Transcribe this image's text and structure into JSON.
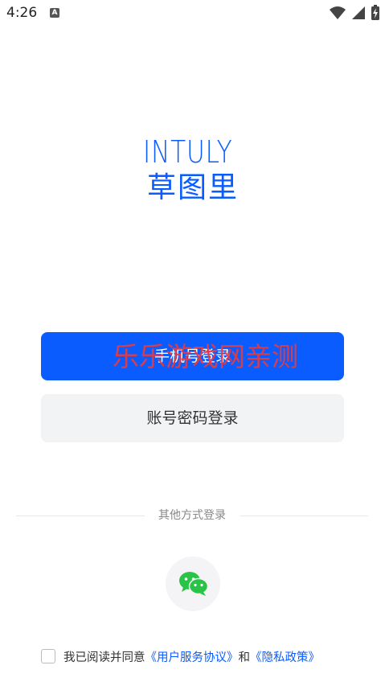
{
  "status_bar": {
    "time": "4:26",
    "notification_icon": "a-icon",
    "icons": [
      "wifi-icon",
      "signal-icon",
      "battery-charging-icon"
    ]
  },
  "logo": {
    "en": "INTULY",
    "cn": "草图里"
  },
  "login": {
    "phone_label": "手机号登录",
    "account_label": "账号密码登录"
  },
  "watermark": "乐乐游戏网亲测",
  "other": {
    "label": "其他方式登录",
    "wechat_icon": "wechat-icon"
  },
  "agreement": {
    "prefix": "我已阅读并同意",
    "terms": "《用户服务协议》",
    "and": "和",
    "privacy": "《隐私政策》"
  },
  "colors": {
    "brand": "#0a5cff",
    "wechat": "#28c445",
    "watermark": "#ee3a3a"
  }
}
